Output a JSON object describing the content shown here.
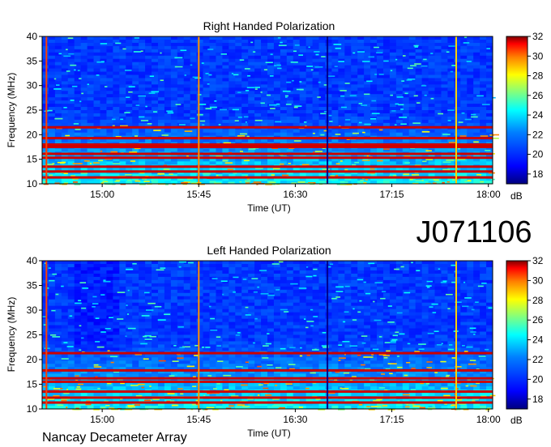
{
  "figure": {
    "id_label": "J071106",
    "footer": "Nancay Decameter Array"
  },
  "colors": {
    "colormap": [
      "#00007f",
      "#0000ff",
      "#0080ff",
      "#00ffff",
      "#80ff80",
      "#ffff00",
      "#ff8000",
      "#ff0000",
      "#7f0000"
    ]
  },
  "chart_data": [
    {
      "type": "heatmap",
      "title": "Right Handed Polarization",
      "xlabel": "Time (UT)",
      "ylabel": "Frequency (MHz)",
      "x_ticks": [
        "15:00",
        "15:45",
        "16:30",
        "17:15",
        "18:00"
      ],
      "y_ticks": [
        "10",
        "15",
        "20",
        "25",
        "30",
        "35",
        "40"
      ],
      "xlim": [
        "14:32",
        "18:02"
      ],
      "ylim": [
        10,
        40
      ],
      "colorbar": {
        "label": "dB",
        "ticks": [
          "18",
          "20",
          "22",
          "24",
          "26",
          "28",
          "30",
          "32"
        ],
        "range": [
          17,
          32
        ]
      },
      "interference_bands_mhz": [
        11.3,
        12.5,
        13.5,
        15.3,
        16.1,
        17.5,
        18.0,
        19.3,
        21.5
      ],
      "vertical_lines_ut": [
        "14:34",
        "15:45",
        "16:45",
        "17:45"
      ]
    },
    {
      "type": "heatmap",
      "title": "Left Handed Polarization",
      "xlabel": "Time (UT)",
      "ylabel": "Frequency (MHz)",
      "x_ticks": [
        "15:00",
        "15:45",
        "16:30",
        "17:15",
        "18:00"
      ],
      "y_ticks": [
        "10",
        "15",
        "20",
        "25",
        "30",
        "35",
        "40"
      ],
      "xlim": [
        "14:32",
        "18:02"
      ],
      "ylim": [
        10,
        40
      ],
      "colorbar": {
        "label": "dB",
        "ticks": [
          "18",
          "20",
          "22",
          "24",
          "26",
          "28",
          "30",
          "32"
        ],
        "range": [
          17,
          32
        ]
      },
      "interference_bands_mhz": [
        11.3,
        12.3,
        13.5,
        15.5,
        16.2,
        17.8,
        21.3
      ],
      "vertical_lines_ut": [
        "14:34",
        "15:45",
        "16:45",
        "17:45"
      ]
    }
  ]
}
